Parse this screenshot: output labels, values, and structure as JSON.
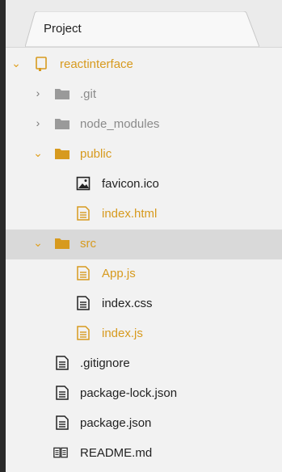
{
  "panel": {
    "tab_title": "Project"
  },
  "tree": {
    "root": {
      "label": "reactinterface",
      "expanded": true
    },
    "items": [
      {
        "label": ".git",
        "type": "folder",
        "expanded": false
      },
      {
        "label": "node_modules",
        "type": "folder",
        "expanded": false
      },
      {
        "label": "public",
        "type": "folder",
        "expanded": true
      },
      {
        "label": "favicon.ico",
        "type": "image-file"
      },
      {
        "label": "index.html",
        "type": "file",
        "modified": true
      },
      {
        "label": "src",
        "type": "folder",
        "expanded": true,
        "selected": true
      },
      {
        "label": "App.js",
        "type": "file",
        "modified": true
      },
      {
        "label": "index.css",
        "type": "file"
      },
      {
        "label": "index.js",
        "type": "file",
        "modified": true
      },
      {
        "label": ".gitignore",
        "type": "file"
      },
      {
        "label": "package-lock.json",
        "type": "file"
      },
      {
        "label": "package.json",
        "type": "file"
      },
      {
        "label": "README.md",
        "type": "readme-file"
      }
    ]
  },
  "colors": {
    "accent_orange": "#d79a1e",
    "ignored_gray": "#8a8a8a",
    "text_dark": "#222222",
    "selection": "#d9d9d9"
  }
}
